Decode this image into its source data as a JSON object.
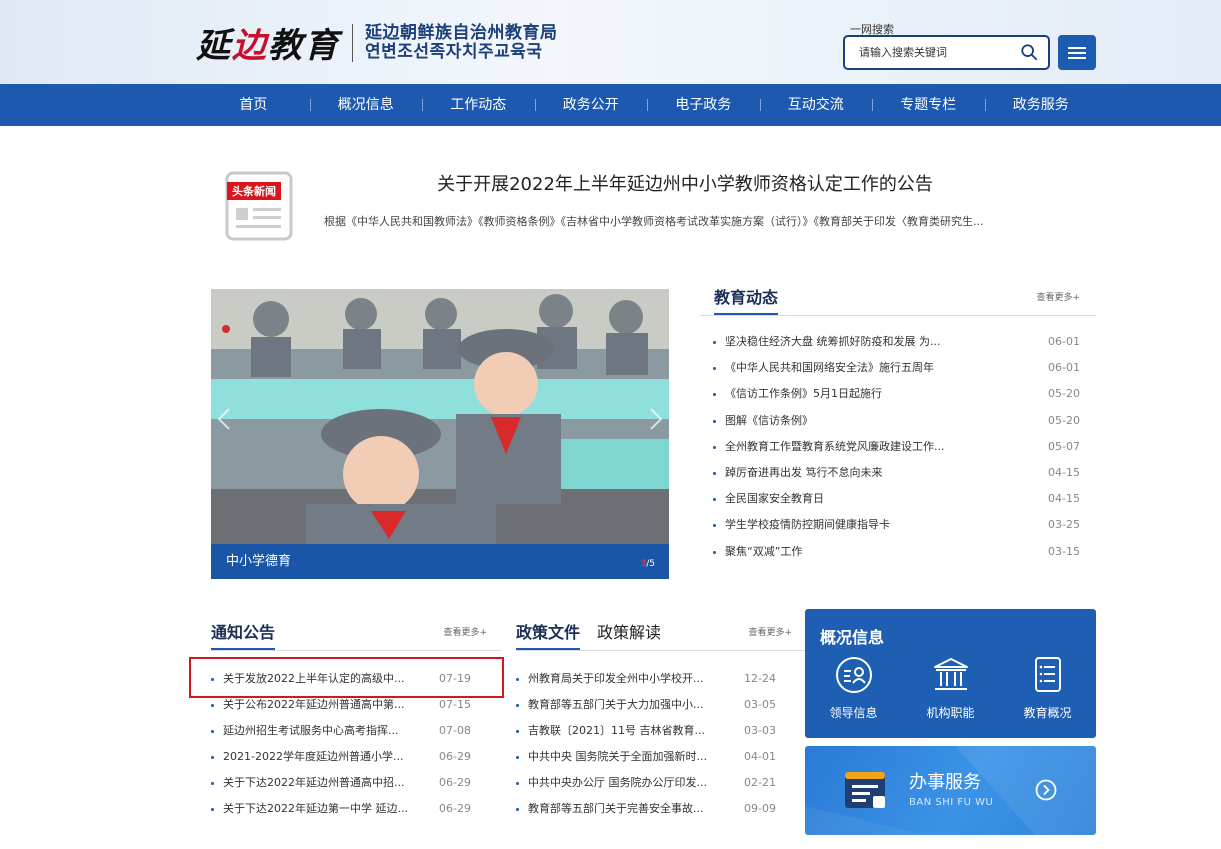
{
  "header": {
    "logo_calligraphy": [
      "延",
      "边",
      "教",
      "育"
    ],
    "org_name_cn": "延边朝鲜族自治州教育局",
    "org_name_kr": "연변조선족자치주교육국",
    "search_label": "一网搜索",
    "search_placeholder": "请输入搜索关键词",
    "menu_icon": "hamburger-menu-icon"
  },
  "nav": {
    "items": [
      "首页",
      "概况信息",
      "工作动态",
      "政务公开",
      "电子政务",
      "互动交流",
      "专题专栏",
      "政务服务"
    ]
  },
  "headline": {
    "icon_label": "头条新闻",
    "title": "关于开展2022年上半年延边州中小学教师资格认定工作的公告",
    "desc": "根据《中华人民共和国教师法》《教师资格条例》《吉林省中小学教师资格考试改革实施方案（试行）》《教育部关于印发〈教育类研究生..."
  },
  "carousel": {
    "caption": "中小学德育",
    "current": "3",
    "total": "/5"
  },
  "edu_news": {
    "title": "教育动态",
    "more": "查看更多+",
    "items": [
      {
        "text": "坚决稳住经济大盘 统筹抓好防疫和发展 为...",
        "date": "06-01"
      },
      {
        "text": "《中华人民共和国网络安全法》施行五周年",
        "date": "06-01"
      },
      {
        "text": "《信访工作条例》5月1日起施行",
        "date": "05-20"
      },
      {
        "text": "图解《信访条例》",
        "date": "05-20"
      },
      {
        "text": "全州教育工作暨教育系统党风廉政建设工作...",
        "date": "05-07"
      },
      {
        "text": "踔厉奋进再出发 笃行不怠向未来",
        "date": "04-15"
      },
      {
        "text": "全民国家安全教育日",
        "date": "04-15"
      },
      {
        "text": "学生学校疫情防控期间健康指导卡",
        "date": "03-25"
      },
      {
        "text": "聚焦“双减”工作",
        "date": "03-15"
      }
    ]
  },
  "notices": {
    "title": "通知公告",
    "more": "查看更多+",
    "items": [
      {
        "text": "关于发放2022上半年认定的高级中...",
        "date": "07-19"
      },
      {
        "text": "关于公布2022年延边州普通高中第...",
        "date": "07-15"
      },
      {
        "text": "延边州招生考试服务中心高考指挥...",
        "date": "07-08"
      },
      {
        "text": "2021-2022学年度延边州普通小学...",
        "date": "06-29"
      },
      {
        "text": "关于下达2022年延边州普通高中招...",
        "date": "06-29"
      },
      {
        "text": "关于下达2022年延边第一中学 延边...",
        "date": "06-29"
      }
    ]
  },
  "policy": {
    "title": "政策文件",
    "title2": "政策解读",
    "more": "查看更多+",
    "items": [
      {
        "text": "州教育局关于印发全州中小学校开...",
        "date": "12-24"
      },
      {
        "text": "教育部等五部门关于大力加强中小...",
        "date": "03-05"
      },
      {
        "text": "吉教联〔2021〕11号 吉林省教育...",
        "date": "03-03"
      },
      {
        "text": "中共中央 国务院关于全面加强新时...",
        "date": "04-01"
      },
      {
        "text": "中共中央办公厅 国务院办公厅印发...",
        "date": "02-21"
      },
      {
        "text": "教育部等五部门关于完善安全事故...",
        "date": "09-09"
      }
    ]
  },
  "overview": {
    "title": "概况信息",
    "items": [
      {
        "label": "领导信息",
        "icon": "leader-profile-icon"
      },
      {
        "label": "机构职能",
        "icon": "institution-building-icon"
      },
      {
        "label": "教育概况",
        "icon": "document-list-icon"
      }
    ]
  },
  "service": {
    "title": "办事服务",
    "subtitle": "BAN SHI FU WU",
    "icon": "service-desk-icon",
    "arrow_icon": "circle-arrow-right-icon"
  },
  "colors": {
    "nav_blue": "#1c59af",
    "title_navy": "#1c2f56",
    "highlight_red": "#d0191f"
  }
}
